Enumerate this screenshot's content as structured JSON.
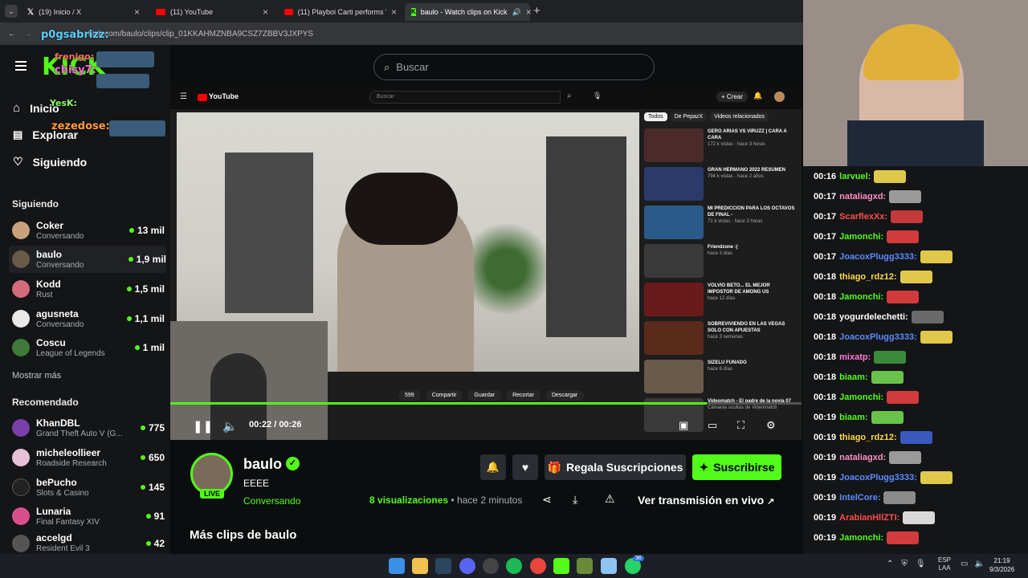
{
  "browser": {
    "tabs": [
      {
        "label": "(19) Inicio / X",
        "icon": "x-logo"
      },
      {
        "label": "(11) YouTube",
        "icon": "youtube-logo"
      },
      {
        "label": "(11) Playboi Carti performs \"OF",
        "icon": "youtube-logo"
      },
      {
        "label": "baulo - Watch clips on Kick",
        "icon": "kick-logo"
      }
    ],
    "url": "kick.com/baulo/clips/clip_01KKAHMZNBA9CSZ7ZBBV3JXPYS"
  },
  "overlay_chat": [
    {
      "user": "p0gsabrizz:",
      "color": "#5ad1ff"
    },
    {
      "user": "frenigo:",
      "color": "#ff6b6b"
    },
    {
      "user": "chisy7:",
      "color": "#ff6fd8"
    },
    {
      "user": "YesK:",
      "color": "#8cff66"
    },
    {
      "user": "zezedose:",
      "color": "#ff9b3d"
    }
  ],
  "nav": {
    "home": "Inicio",
    "explore": "Explorar",
    "following": "Siguiendo"
  },
  "search": {
    "placeholder": "Buscar"
  },
  "following_section": {
    "title": "Siguiendo",
    "channels": [
      {
        "name": "Coker",
        "game": "Conversando",
        "viewers": "13 mil"
      },
      {
        "name": "baulo",
        "game": "Conversando",
        "viewers": "1,9 mil"
      },
      {
        "name": "Kodd",
        "game": "Rust",
        "viewers": "1,5 mil"
      },
      {
        "name": "agusneta",
        "game": "Conversando",
        "viewers": "1,1 mil"
      },
      {
        "name": "Coscu",
        "game": "League of Legends",
        "viewers": "1 mil"
      }
    ],
    "show_more": "Mostrar más"
  },
  "recommended_section": {
    "title": "Recomendado",
    "channels": [
      {
        "name": "KhanDBL",
        "game": "Grand Theft Auto V (G...",
        "viewers": "775"
      },
      {
        "name": "micheleollieer",
        "game": "Roadside Research",
        "viewers": "650"
      },
      {
        "name": "bePucho",
        "game": "Slots & Casino",
        "viewers": "145"
      },
      {
        "name": "Lunaria",
        "game": "Final Fantasy XIV",
        "viewers": "91"
      },
      {
        "name": "accelgd",
        "game": "Resident Evil 3",
        "viewers": "42"
      }
    ]
  },
  "youtube": {
    "logo": "YouTube",
    "search_placeholder": "Buscar",
    "create": "+ Crear",
    "chips": [
      "Todos",
      "De PepazX",
      "Videos relacionados"
    ],
    "actions": [
      "599",
      "Compartir",
      "Guardar",
      "Recortar",
      "Descargar"
    ],
    "recs": [
      {
        "title": "GERO ARIAS VS VIRUZZ | CARA A CARA",
        "meta": "172 k vistas · hace 3 horas"
      },
      {
        "title": "GRAN HERMANO 2022 RESUMEN",
        "meta": "794 k vistas · hace 2 años"
      },
      {
        "title": "MI PREDICCION PARA LOS OCTAVOS DE FINAL -",
        "meta": "71 k vistas · hace 3 horas"
      },
      {
        "title": "Friendzone :(",
        "meta": "hace 3 días"
      },
      {
        "title": "VOLVIÓ BETO... EL MEJOR IMPOSTOR DE AMONG US",
        "meta": "hace 12 días"
      },
      {
        "title": "SOBREVIVIENDO EN LAS VEGAS SOLO CON APUESTAS",
        "meta": "hace 3 semanas"
      },
      {
        "title": "SIZELU FUNADO",
        "meta": "hace 6 días"
      },
      {
        "title": "Videomatch - El padre de la novia 07",
        "meta": "Cámaras ocultas de Videomatch"
      }
    ]
  },
  "player": {
    "time_current": "00:22",
    "time_total": "00:26",
    "progress_fraction": 0.85
  },
  "stream": {
    "channel": "baulo",
    "clip_title": "EEEE",
    "category": "Conversando",
    "live_badge": "LIVE",
    "views": "8",
    "views_label": " visualizaciones",
    "time_ago": "• hace 2 minutos",
    "gift_label": "Regala Suscripciones",
    "subscribe_label": "Suscribirse",
    "watch_live_label": "Ver transmisión en vivo",
    "more_clips": "Más clips de baulo"
  },
  "chat": [
    {
      "time": "00:16",
      "user": "larvuel:",
      "color": "#53fc18"
    },
    {
      "time": "00:17",
      "user": "nataliagxd:",
      "color": "#ff8fc8"
    },
    {
      "time": "00:17",
      "user": "ScarflexXx:",
      "color": "#ff4d4d"
    },
    {
      "time": "00:17",
      "user": "Jamonchi:",
      "color": "#53fc18"
    },
    {
      "time": "00:17",
      "user": "JoacoxPlugg3333:",
      "color": "#5b8cff"
    },
    {
      "time": "00:18",
      "user": "thiago_rdz12:",
      "color": "#ffd84d"
    },
    {
      "time": "00:18",
      "user": "Jamonchi:",
      "color": "#53fc18"
    },
    {
      "time": "00:18",
      "user": "yogurdelechetti:",
      "color": "#ffffff"
    },
    {
      "time": "00:18",
      "user": "JoacoxPlugg3333:",
      "color": "#5b8cff"
    },
    {
      "time": "00:18",
      "user": "mixatp:",
      "color": "#ff7ad9"
    },
    {
      "time": "00:18",
      "user": "biaam:",
      "color": "#53fc18"
    },
    {
      "time": "00:18",
      "user": "Jamonchi:",
      "color": "#53fc18"
    },
    {
      "time": "00:19",
      "user": "biaam:",
      "color": "#53fc18"
    },
    {
      "time": "00:19",
      "user": "thiago_rdz12:",
      "color": "#ffd84d"
    },
    {
      "time": "00:19",
      "user": "nataliagxd:",
      "color": "#ff8fc8"
    },
    {
      "time": "00:19",
      "user": "JoacoxPlugg3333:",
      "color": "#5b8cff"
    },
    {
      "time": "00:19",
      "user": "IntelCore:",
      "color": "#5b8cff"
    },
    {
      "time": "00:19",
      "user": "ArabianHllZTI:",
      "color": "#ff4d4d"
    },
    {
      "time": "00:19",
      "user": "Jamonchi:",
      "color": "#53fc18"
    }
  ],
  "taskbar": {
    "lang": "ESP",
    "lang2": "LAA",
    "time": "21:19",
    "date": "9/3/2026",
    "whatsapp_badge": "36"
  },
  "colors": {
    "accent": "#53fc18",
    "bg": "#0b0e0f",
    "sidebar": "#141517"
  }
}
